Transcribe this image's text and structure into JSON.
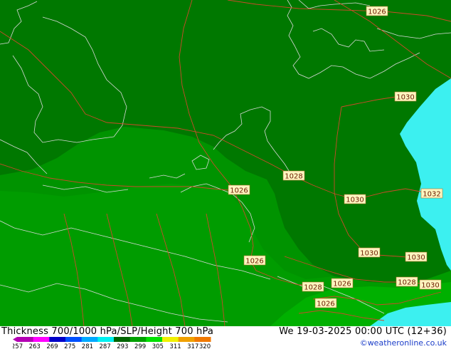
{
  "map": {
    "isobar_labels": [
      {
        "text": "1026"
      },
      {
        "text": "1030"
      },
      {
        "text": "1028"
      },
      {
        "text": "1026"
      },
      {
        "text": "1030"
      },
      {
        "text": "1032"
      },
      {
        "text": "1026"
      },
      {
        "text": "1030"
      },
      {
        "text": "1030"
      },
      {
        "text": "1028"
      },
      {
        "text": "1026"
      },
      {
        "text": "1028"
      },
      {
        "text": "1030"
      },
      {
        "text": "1026"
      }
    ],
    "colors": {
      "dark_green": "#007800",
      "mid_green": "#009600",
      "light_green": "#00b400",
      "cyan": "#3cf0f0",
      "isobar": "#cc4a2a",
      "coast": "#d8d8d8"
    }
  },
  "footer": {
    "title": "Thickness 700/1000 hPa/SLP/Height 700 hPa",
    "valid_time": "We 19-03-2025 00:00 UTC (12+36)",
    "credit": "©weatheronline.co.uk",
    "scale": {
      "ticks": [
        "257",
        "263",
        "269",
        "275",
        "281",
        "287",
        "293",
        "299",
        "305",
        "311",
        "317",
        "320"
      ],
      "colors": [
        "#b400b4",
        "#ff00ff",
        "#0000c8",
        "#0050ff",
        "#00aaff",
        "#00f0f0",
        "#006400",
        "#00a000",
        "#00e000",
        "#f0f000",
        "#f0a000",
        "#f07800"
      ]
    }
  }
}
